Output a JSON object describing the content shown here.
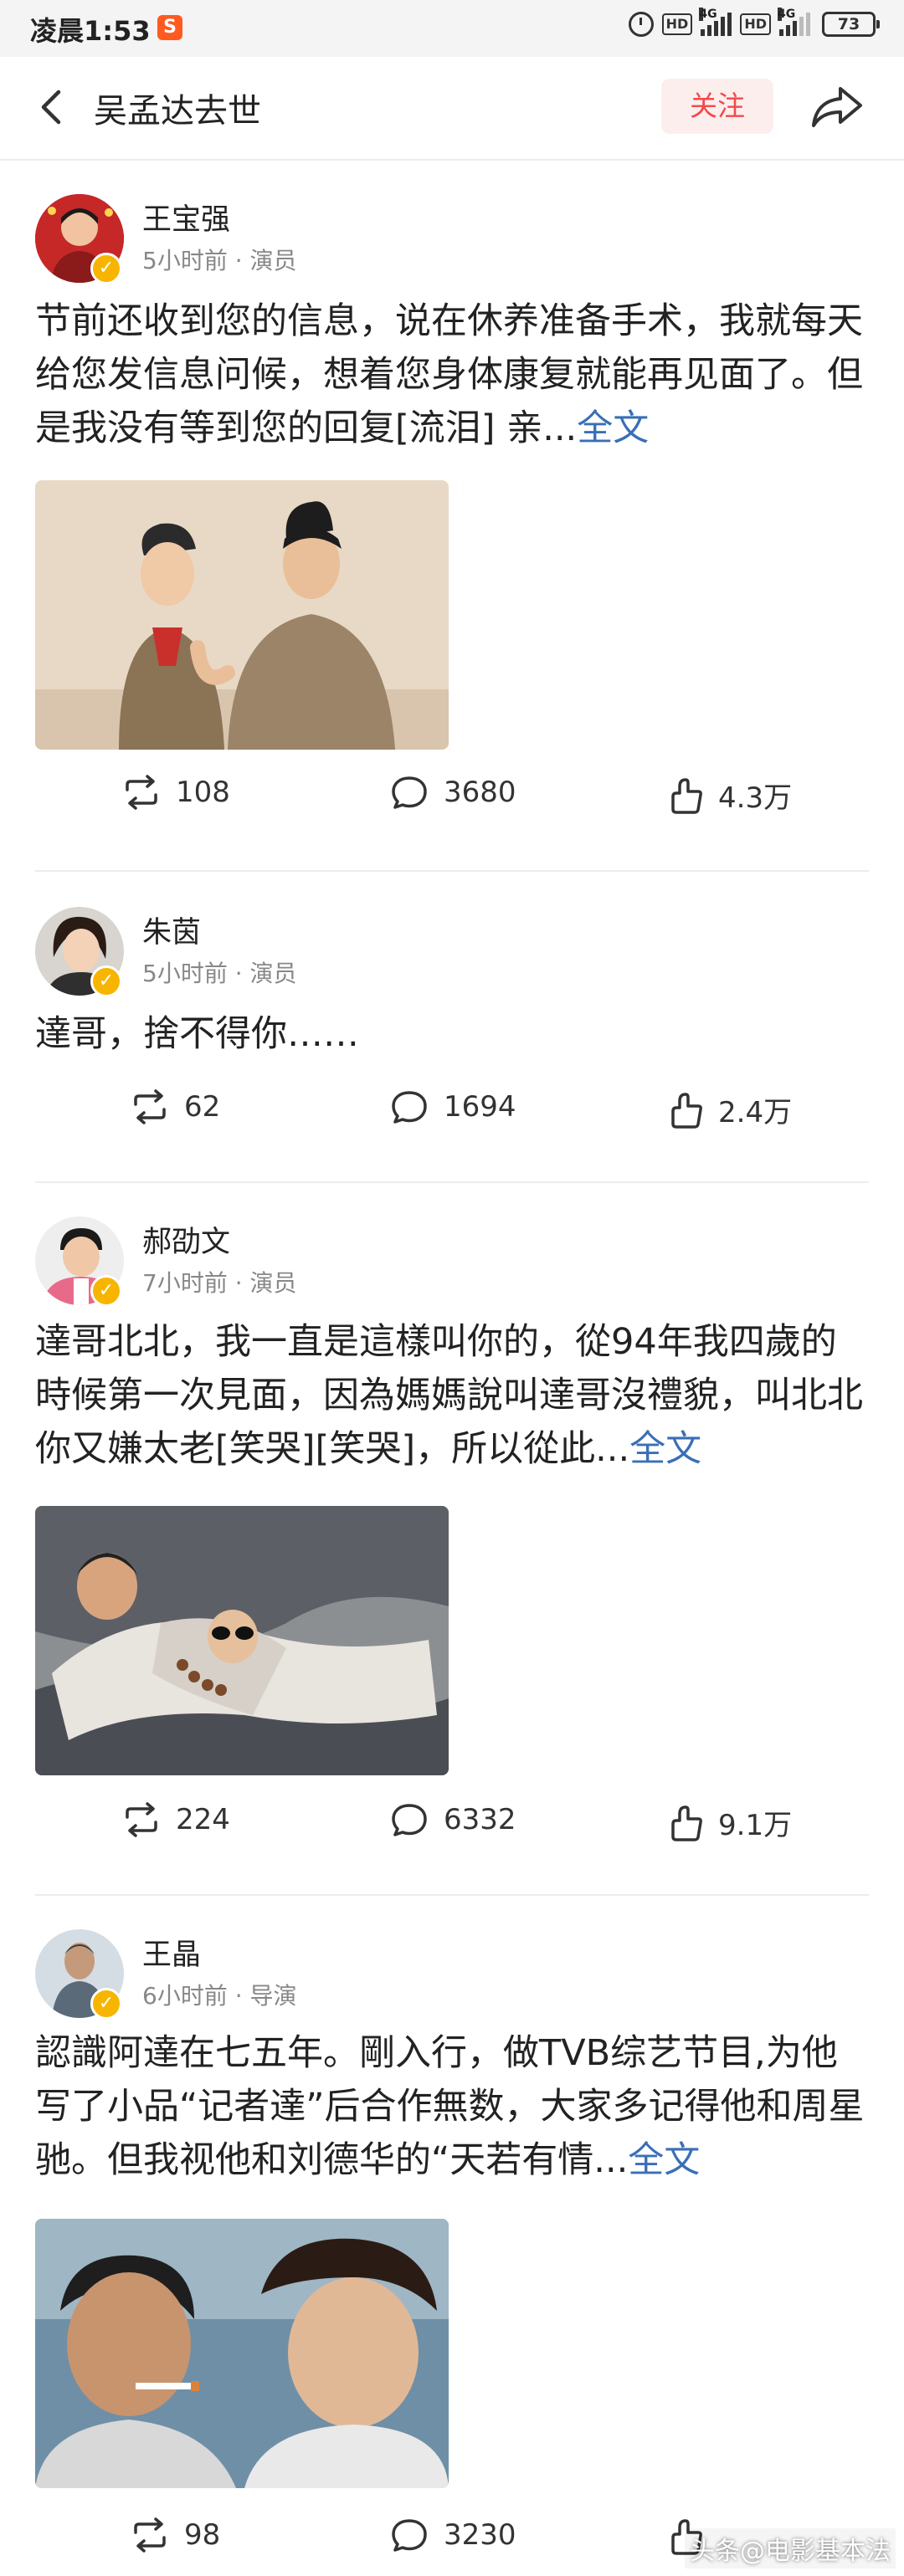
{
  "status_bar": {
    "time": "凌晨1:53",
    "app_icon": "S",
    "hd1": "HD",
    "hd2": "HD",
    "net1": "4G",
    "net2": "4G",
    "battery": "73"
  },
  "header": {
    "title": "吴孟达去世",
    "follow_label": "关注"
  },
  "posts": [
    {
      "author": "王宝强",
      "meta": "5小时前 · 演员",
      "text": "节前还收到您的信息，说在休养准备手术，我就每天给您发信息问候，想着您身体康复就能再见面了。但是我没有等到您的回复[流泪] 亲...",
      "more": "全文",
      "repost": "108",
      "comment": "3680",
      "like": "4.3万"
    },
    {
      "author": "朱茵",
      "meta": "5小时前 · 演员",
      "text": "達哥，捨不得你……",
      "repost": "62",
      "comment": "1694",
      "like": "2.4万"
    },
    {
      "author": "郝劭文",
      "meta": "7小时前 · 演员",
      "text": "達哥北北，我一直是這樣叫你的，從94年我四歲的時候第一次見面，因為媽媽說叫達哥沒禮貌，叫北北你又嫌太老[笑哭][笑哭]，所以從此...",
      "more": "全文",
      "repost": "224",
      "comment": "6332",
      "like": "9.1万"
    },
    {
      "author": "王晶",
      "meta": "6小时前 · 导演",
      "text": "認識阿達在七五年。剛入行，做TVB综艺节目,为他写了小品“记者達”后合作無数，大家多记得他和周星驰。但我视他和刘德华的“天若有情...",
      "more": "全文",
      "repost": "98",
      "comment": "3230"
    }
  ],
  "watermark": "头条@电影基本法",
  "colors": {
    "accent_link": "#3a6fb7",
    "follow_text": "#f14b4b",
    "follow_bg": "#fdeeee",
    "verified": "#f7b500"
  },
  "icons": [
    "back-icon",
    "share-icon",
    "repost-icon",
    "comment-icon",
    "like-icon",
    "verified-icon",
    "alarm-icon",
    "signal-icon",
    "battery-icon"
  ]
}
